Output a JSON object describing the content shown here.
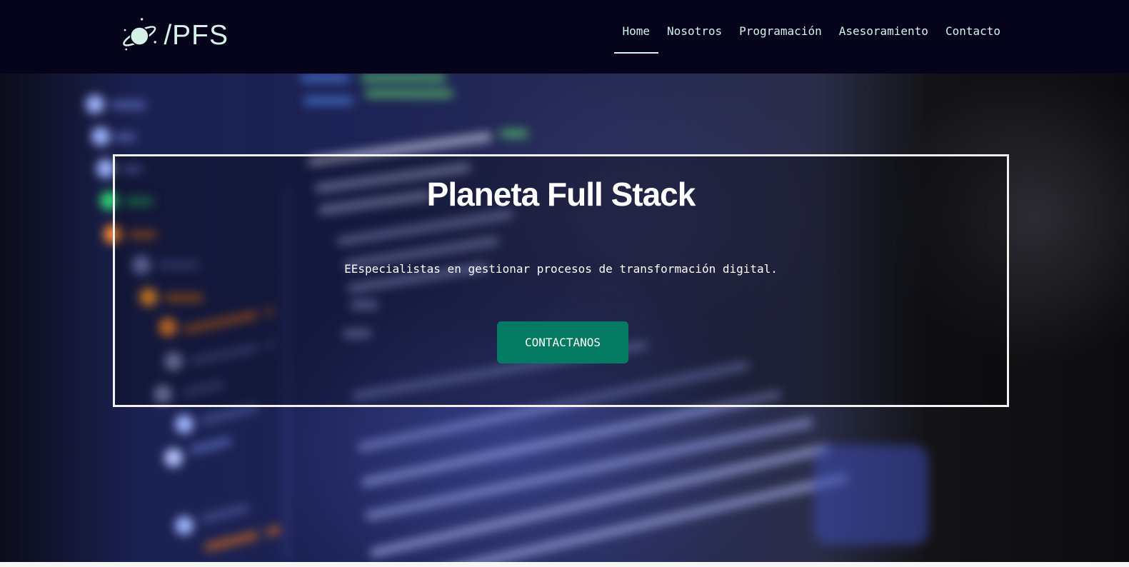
{
  "header": {
    "logo_text": "/PFS",
    "logo_icon": "planet-icon",
    "nav": [
      {
        "label": "Home",
        "active": true
      },
      {
        "label": "Nosotros",
        "active": false
      },
      {
        "label": "Programación",
        "active": false
      },
      {
        "label": "Asesoramiento",
        "active": false
      },
      {
        "label": "Contacto",
        "active": false
      }
    ]
  },
  "hero": {
    "title": "Planeta Full Stack",
    "subtitle": "EEspecialistas en gestionar procesos de transformación digital.",
    "cta_label": "CONTACTANOS",
    "background": "blurred-code-editor-image"
  },
  "colors": {
    "header_bg": "#06041a",
    "nav_text": "#d4f3ec",
    "cta_bg": "#047a63",
    "box_border": "#f2f2f2"
  }
}
